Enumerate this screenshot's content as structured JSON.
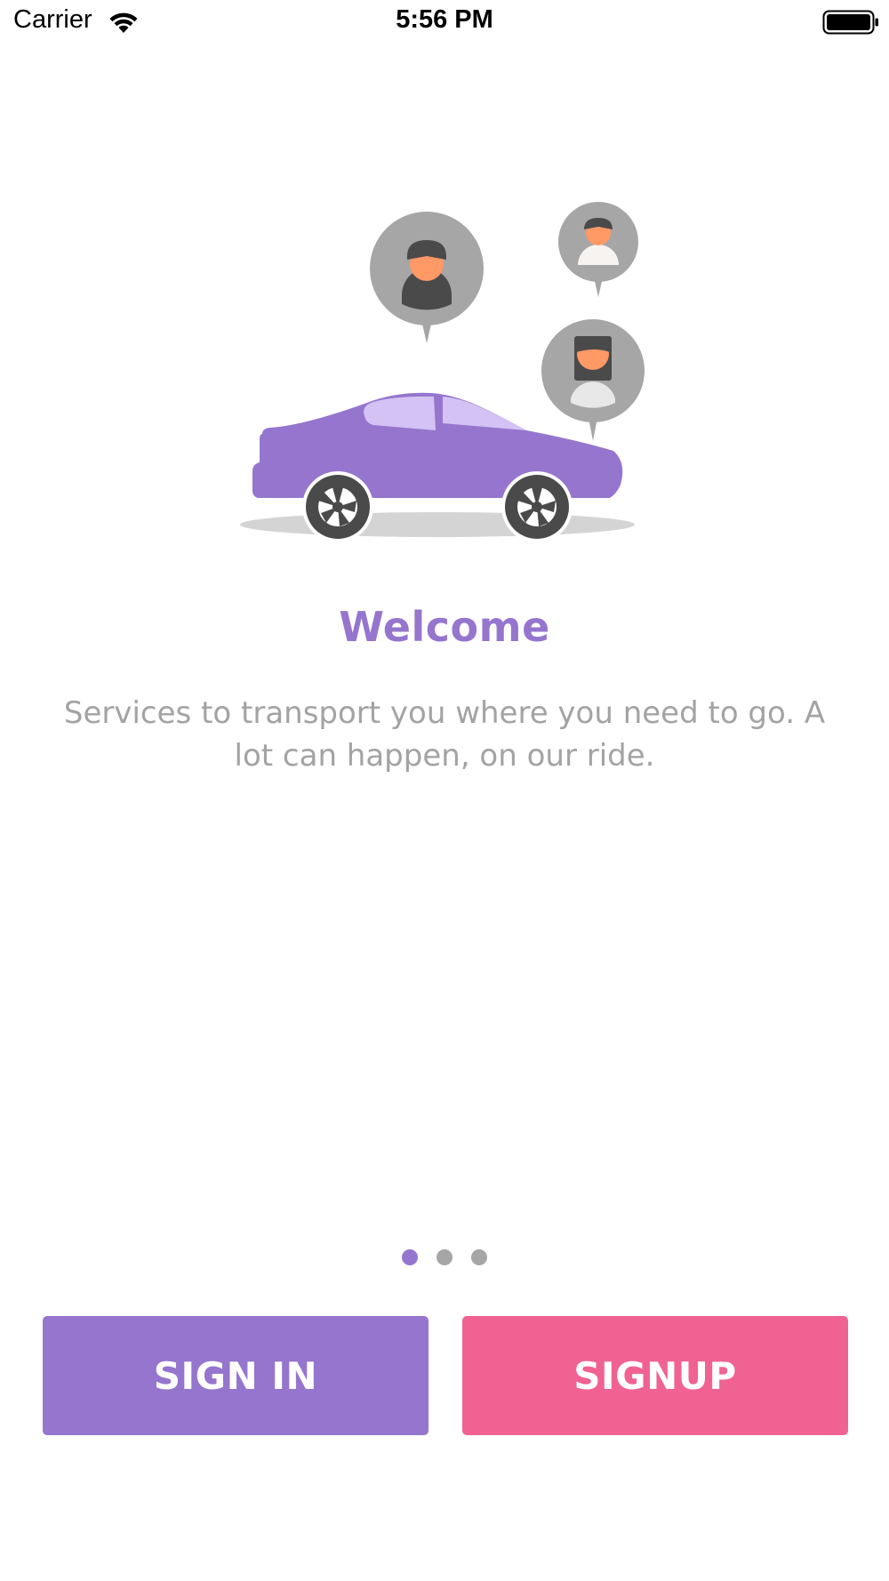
{
  "status_bar": {
    "carrier": "Carrier",
    "time": "5:56 PM",
    "wifi_icon": "wifi-icon",
    "battery_icon": "battery-full-icon"
  },
  "illustration": {
    "icon": "car-with-passengers-illustration",
    "colors": {
      "car": "#9575cd",
      "window": "#d4c2f5",
      "avatar_bubble": "#a6a6a6",
      "skin": "#ff9966"
    }
  },
  "onboarding": {
    "title": "Welcome",
    "description": "Services to transport you where you need to go. A lot can happen, on our ride.",
    "pages": 3,
    "current_page": 1
  },
  "actions": {
    "signin_label": "SIGN IN",
    "signup_label": "SIGNUP"
  },
  "colors": {
    "primary": "#9575cd",
    "secondary": "#f06292",
    "text_muted": "#a3a3a3"
  }
}
